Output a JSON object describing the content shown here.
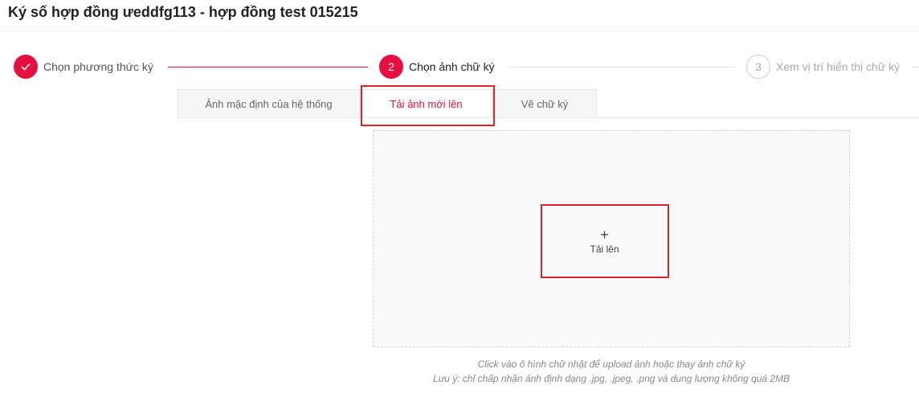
{
  "page": {
    "title": "Ký số hợp đồng ưeddfg113 - hợp đồng test 015215"
  },
  "steps": [
    {
      "number": "✓",
      "label": "Chọn phương thức ký",
      "state": "done"
    },
    {
      "number": "2",
      "label": "Chọn ảnh chữ ký",
      "state": "active"
    },
    {
      "number": "3",
      "label": "Xem vị trí hiển thị chữ ký",
      "state": "pending"
    }
  ],
  "tabs": [
    {
      "label": "Ảnh mặc định của hệ thống",
      "active": false
    },
    {
      "label": "Tải ảnh mới lên",
      "active": true
    },
    {
      "label": "Vẽ chữ ký",
      "active": false
    }
  ],
  "upload": {
    "icon": "+",
    "label": "Tải lên",
    "hint": "Click vào ô hình chữ nhật để upload ảnh hoặc thay ảnh chữ ký",
    "note": "Lưu ý: chỉ chấp nhận ảnh định dạng .jpg, .jpeg, .png và dung lượng không quá 2MB"
  },
  "colors": {
    "accent": "#e60f3f",
    "highlight": "#d9252e"
  }
}
